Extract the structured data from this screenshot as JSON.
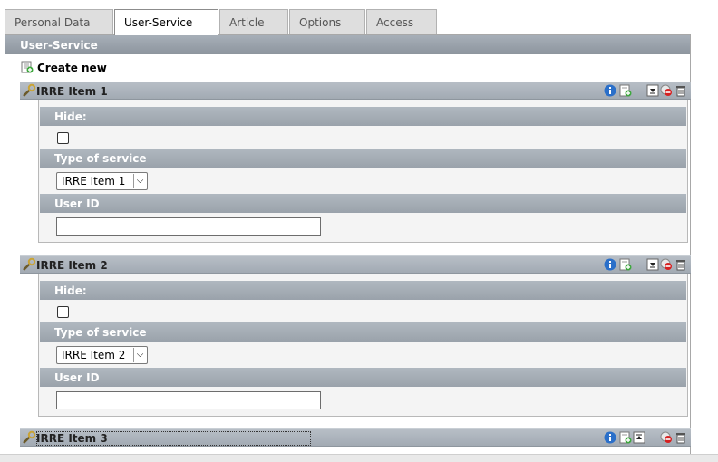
{
  "tabs": [
    {
      "label": "Personal Data",
      "active": false
    },
    {
      "label": "User-Service",
      "active": true
    },
    {
      "label": "Article",
      "active": false
    },
    {
      "label": "Options",
      "active": false
    },
    {
      "label": "Access",
      "active": false
    }
  ],
  "panel": {
    "header": "User-Service",
    "create_new": "Create new"
  },
  "items": [
    {
      "title": "IRRE Item 1",
      "hide_label": "Hide:",
      "hide_checked": false,
      "type_label": "Type of service",
      "type_value": "IRRE Item 1",
      "userid_label": "User ID",
      "userid_value": ""
    },
    {
      "title": "IRRE Item 2",
      "hide_label": "Hide:",
      "hide_checked": false,
      "type_label": "Type of service",
      "type_value": "IRRE Item 2",
      "userid_label": "User ID",
      "userid_value": ""
    },
    {
      "title": "IRRE Item 3"
    }
  ],
  "colors": {
    "header_bg": "#969ea7",
    "tab_active_bg": "#ffffff",
    "tab_bg": "#dedede",
    "info_blue": "#2a6fc9",
    "delete_red": "#d62020"
  }
}
